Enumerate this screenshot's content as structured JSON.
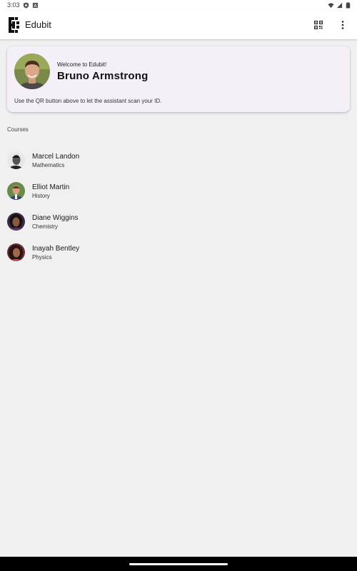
{
  "status_bar": {
    "time": "3:03",
    "left_icons": [
      "shield-icon",
      "a-badge-icon"
    ],
    "right_icons": [
      "wifi-icon",
      "signal-icon",
      "battery-icon"
    ]
  },
  "app_bar": {
    "title": "Edubit",
    "actions": [
      "qr-code-icon",
      "more-vert-icon"
    ]
  },
  "welcome_card": {
    "greeting": "Welcome to Edubit!",
    "name": "Bruno Armstrong",
    "hint": "Use the QR button above to let the assistant scan your ID."
  },
  "courses": {
    "label": "Courses",
    "items": [
      {
        "teacher": "Marcel Landon",
        "subject": "Mathematics"
      },
      {
        "teacher": "Elliot Martin",
        "subject": "History"
      },
      {
        "teacher": "Diane Wiggins",
        "subject": "Chemistry"
      },
      {
        "teacher": "Inayah Bentley",
        "subject": "Physics"
      }
    ]
  },
  "colors": {
    "background": "#f0f0f0",
    "surface": "#ffffff",
    "card": "#f5f0f7",
    "nav_bar": "#000000"
  }
}
